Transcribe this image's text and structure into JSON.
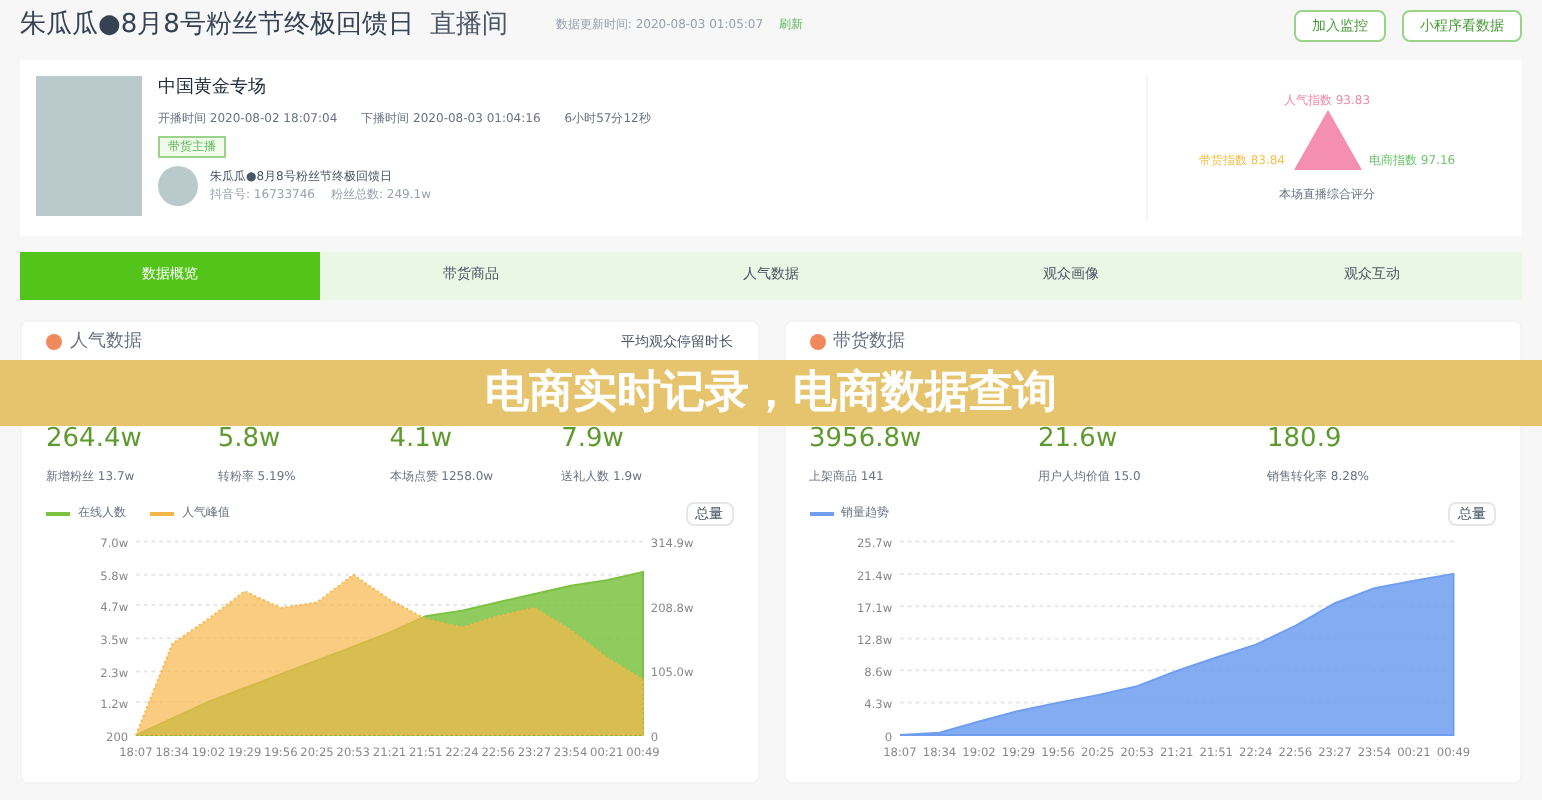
{
  "header": {
    "title": "朱瓜瓜●8月8号粉丝节终极回馈日",
    "subtitle": "直播间",
    "update_time": "数据更新时间: 2020-08-03 01:05:07",
    "refresh": "刷新",
    "buttons": [
      "加入监控",
      "小程序看数据"
    ]
  },
  "live": {
    "name": "中国黄金专场",
    "start": "开播时间 2020-08-02 18:07:04",
    "end": "下播时间 2020-08-03 01:04:16",
    "duration": "6小时57分12秒",
    "tag": "带货主播",
    "anchor": "朱瓜瓜●8月8号粉丝节终极回馈日",
    "account": "抖音号: 16733746",
    "fans": "粉丝总数: 249.1w"
  },
  "score": {
    "top": "人气指数 93.83",
    "left": "带货指数 83.84",
    "right": "电商指数 97.16",
    "caption": "本场直播综合评分"
  },
  "tabs": [
    {
      "label": "数据概览",
      "selected": true
    },
    {
      "label": "带货商品",
      "selected": false
    },
    {
      "label": "人气数据",
      "selected": false
    },
    {
      "label": "观众画像",
      "selected": false
    },
    {
      "label": "观众互动",
      "selected": false
    }
  ],
  "banner": "电商实时记录，电商数据查询",
  "panels": [
    {
      "title": "人气数据",
      "note": "平均观众停留时长",
      "stats": [
        {
          "value": "264.4w",
          "sub": "新增粉丝 13.7w"
        },
        {
          "value": "5.8w",
          "sub": "转粉率 5.19%"
        },
        {
          "value": "4.1w",
          "sub": "本场点赞 1258.0w"
        },
        {
          "value": "7.9w",
          "sub": "送礼人数 1.9w"
        }
      ],
      "toggle": "总量",
      "right_axis_labels": [
        "314.9w",
        "208.8w",
        "105.0w",
        "0"
      ],
      "chart_data": {
        "type": "area",
        "grid": true,
        "categories": [
          "18:07",
          "18:34",
          "19:02",
          "19:29",
          "19:56",
          "20:25",
          "20:53",
          "21:21",
          "21:51",
          "22:24",
          "22:56",
          "23:27",
          "23:54",
          "00:21",
          "00:49"
        ],
        "yticks": [
          {
            "value": 1.2,
            "label": "1.2w"
          },
          {
            "value": 2.3,
            "label": "2.3w"
          },
          {
            "value": 3.5,
            "label": "3.5w"
          },
          {
            "value": 4.7,
            "label": "4.7w"
          },
          {
            "value": 5.8,
            "label": "5.8w"
          },
          {
            "value": 7.0,
            "label": "7.0w"
          }
        ],
        "ylim": [
          0,
          7.0
        ],
        "series": [
          {
            "name": "在线人数",
            "color": "#7cc242",
            "values": [
              0,
              0.6,
              1.2,
              1.7,
              2.2,
              2.7,
              3.2,
              3.7,
              4.3,
              4.5,
              4.8,
              5.1,
              5.4,
              5.6,
              5.9
            ]
          },
          {
            "name": "人气峰值",
            "color": "#f7b64a",
            "values": [
              0,
              3.3,
              4.2,
              5.2,
              4.6,
              4.8,
              5.8,
              4.9,
              4.2,
              3.9,
              4.3,
              4.6,
              3.8,
              2.8,
              2.0
            ]
          }
        ]
      },
      "axis_bottom_label": "200"
    },
    {
      "title": "带货数据",
      "stats": [
        {
          "value": "3956.8w",
          "sub": "上架商品 141"
        },
        {
          "value": "21.6w",
          "sub": "用户人均价值 15.0"
        },
        {
          "value": "180.9",
          "sub": "销售转化率 8.28%"
        }
      ],
      "toggle": "总量",
      "chart_data": {
        "type": "area",
        "grid": true,
        "categories": [
          "18:07",
          "18:34",
          "19:02",
          "19:29",
          "19:56",
          "20:25",
          "20:53",
          "21:21",
          "21:51",
          "22:24",
          "22:56",
          "23:27",
          "23:54",
          "00:21",
          "00:49"
        ],
        "yticks": [
          {
            "value": 0,
            "label": "0"
          },
          {
            "value": 4.3,
            "label": "4.3w"
          },
          {
            "value": 8.6,
            "label": "8.6w"
          },
          {
            "value": 12.8,
            "label": "12.8w"
          },
          {
            "value": 17.1,
            "label": "17.1w"
          },
          {
            "value": 21.4,
            "label": "21.4w"
          },
          {
            "value": 25.7,
            "label": "25.7w"
          }
        ],
        "ylim": [
          0,
          25.7
        ],
        "series": [
          {
            "name": "销量趋势",
            "color": "#6f9ef0",
            "values": [
              0,
              0.3,
              1.8,
              3.2,
              4.3,
              5.3,
              6.5,
              8.5,
              10.3,
              12.0,
              14.5,
              17.5,
              19.5,
              20.5,
              21.4
            ]
          }
        ]
      }
    }
  ]
}
